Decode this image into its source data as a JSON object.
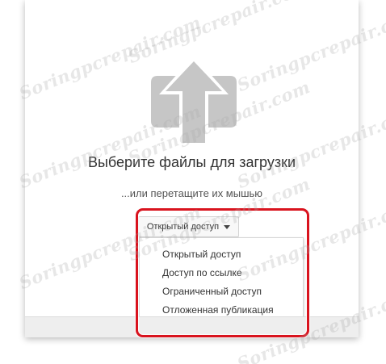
{
  "upload": {
    "icon": "upload-arrow-icon",
    "title": "Выберите файлы для загрузки",
    "subtitle": "...или перетащите их мышью"
  },
  "privacy": {
    "selected": "Открытый доступ",
    "options": [
      "Открытый доступ",
      "Доступ по ссылке",
      "Ограниченный доступ",
      "Отложенная публикация"
    ]
  },
  "watermark": {
    "text": "Soringpcrepair.com"
  },
  "colors": {
    "icon_gray": "#c6c6c6",
    "highlight_red": "#d9131e",
    "text_dark": "#333333"
  }
}
